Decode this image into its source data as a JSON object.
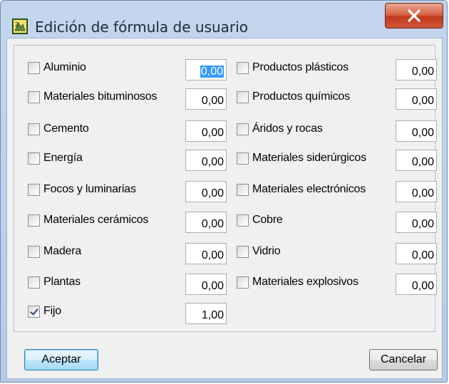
{
  "window": {
    "title": "Edición de fórmula de usuario"
  },
  "items_left": [
    {
      "label": "Aluminio",
      "value": "0,00",
      "checked": false
    },
    {
      "label": "Materiales bituminosos",
      "value": "0,00",
      "checked": false
    },
    {
      "label": "Cemento",
      "value": "0,00",
      "checked": false
    },
    {
      "label": "Energía",
      "value": "0,00",
      "checked": false
    },
    {
      "label": "Focos y luminarias",
      "value": "0,00",
      "checked": false
    },
    {
      "label": "Materiales cerámicos",
      "value": "0,00",
      "checked": false
    },
    {
      "label": "Madera",
      "value": "0,00",
      "checked": false
    },
    {
      "label": "Plantas",
      "value": "0,00",
      "checked": false
    },
    {
      "label": "Fijo",
      "value": "1,00",
      "checked": true
    }
  ],
  "items_right": [
    {
      "label": "Productos plásticos",
      "value": "0,00",
      "checked": false
    },
    {
      "label": "Productos químicos",
      "value": "0,00",
      "checked": false
    },
    {
      "label": "Áridos y rocas",
      "value": "0,00",
      "checked": false
    },
    {
      "label": "Materiales siderúrgicos",
      "value": "0,00",
      "checked": false
    },
    {
      "label": "Materiales electrónicos",
      "value": "0,00",
      "checked": false
    },
    {
      "label": "Cobre",
      "value": "0,00",
      "checked": false
    },
    {
      "label": "Vidrio",
      "value": "0,00",
      "checked": false
    },
    {
      "label": "Materiales explosivos",
      "value": "0,00",
      "checked": false
    }
  ],
  "buttons": {
    "accept": "Aceptar",
    "cancel": "Cancelar"
  },
  "icons": {
    "app": "formula-app-icon",
    "close": "close-icon"
  },
  "colors": {
    "selection": "#3399ff",
    "close": "#c1391d",
    "titlebar": "#c3d6ed"
  }
}
